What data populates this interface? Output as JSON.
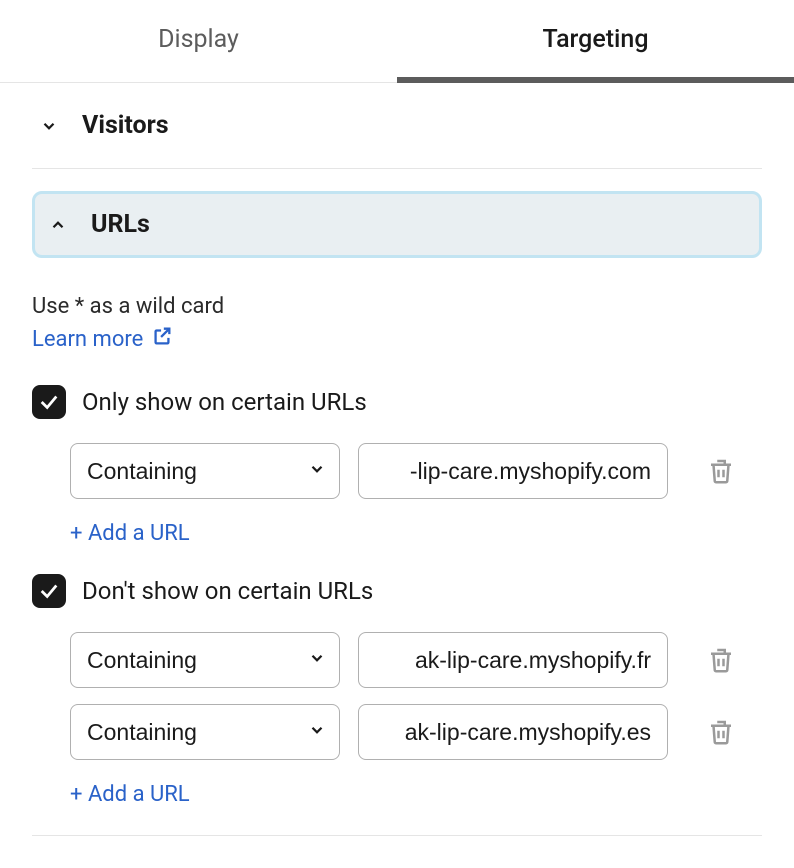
{
  "tabs": {
    "display": "Display",
    "targeting": "Targeting"
  },
  "visitors": {
    "title": "Visitors"
  },
  "urls": {
    "title": "URLs",
    "hint": "Use * as a wild card",
    "learn_more": "Learn more",
    "only_show": {
      "label": "Only show on certain URLs",
      "checked": true,
      "rows": [
        {
          "match": "Containing",
          "value": "-lip-care.myshopify.com"
        }
      ],
      "add_label": "+ Add a URL"
    },
    "dont_show": {
      "label": "Don't show on certain URLs",
      "checked": true,
      "rows": [
        {
          "match": "Containing",
          "value": "ak-lip-care.myshopify.fr"
        },
        {
          "match": "Containing",
          "value": "ak-lip-care.myshopify.es"
        }
      ],
      "add_label": "+ Add a URL"
    }
  }
}
